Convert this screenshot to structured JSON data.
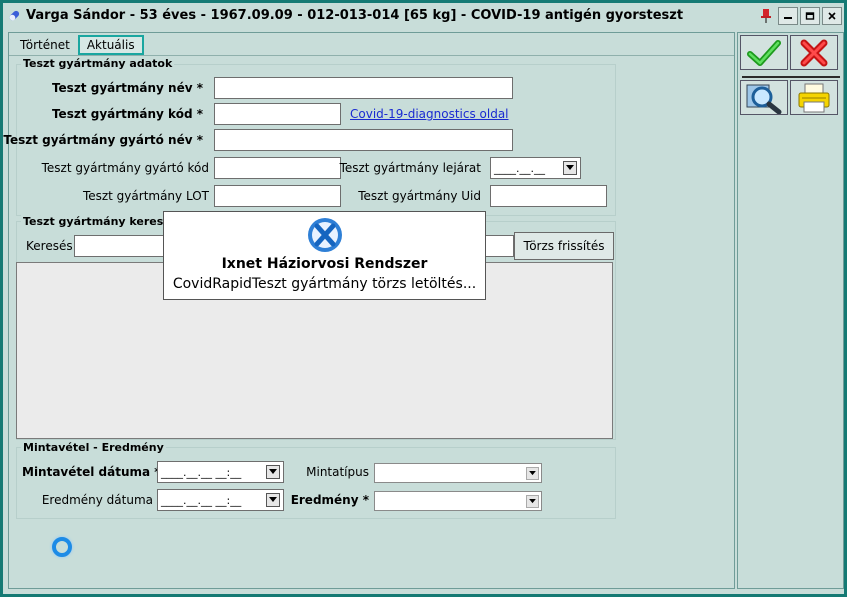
{
  "window": {
    "title": "Varga Sándor - 53 éves - 1967.09.09 - 012-013-014 [65 kg] - COVID-19 antigén gyorsteszt",
    "title_icon": "pill-icon",
    "controls": [
      "pin-icon",
      "minimize-icon",
      "restore-icon",
      "close-icon"
    ]
  },
  "tabs": [
    {
      "label": "Történet",
      "active": false
    },
    {
      "label": "Aktuális",
      "active": true
    }
  ],
  "teszt_adatok": {
    "legend": "Teszt gyártmány adatok",
    "nev_label": "Teszt gyártmány név *",
    "kod_label": "Teszt gyártmány kód *",
    "link_label": "Covid-19-diagnostics oldal",
    "gyarto_nev_label": "Teszt gyártmány gyártó név *",
    "gyarto_kod_label": "Teszt gyártmány gyártó kód",
    "lejarat_label": "Teszt gyártmány lejárat",
    "lejarat_value": "____.__.__",
    "lot_label": "Teszt gyártmány LOT",
    "uid_label": "Teszt gyártmány Uid"
  },
  "kereses": {
    "legend": "Teszt gyártmány keresés",
    "kereses_label": "Keresés",
    "torzs_button": "Törzs frissítés"
  },
  "popup": {
    "title": "Ixnet Háziorvosi Rendszer",
    "message": "CovidRapidTeszt gyártmány törzs letöltés..."
  },
  "mintavetel": {
    "legend": "Mintavétel - Eredmény",
    "datum_label": "Mintavétel dátuma *",
    "datum_value": "____.__.__ __:__",
    "mintatipus_label": "Mintatípus",
    "eredmeny_datum_label": "Eredmény dátuma",
    "eredmeny_datum_value": "____.__.__ __:__",
    "eredmeny_label": "Eredmény *"
  },
  "toolbar": {
    "ok_icon": "checkmark-icon",
    "cancel_icon": "red-x-icon",
    "search_icon": "magnifier-icon",
    "print_icon": "printer-icon"
  },
  "colors": {
    "background": "#c8ddd9",
    "border": "#157a74",
    "link": "#1a2bd1",
    "check_green": "#2cbe2c",
    "cancel_red": "#e01b1b"
  }
}
